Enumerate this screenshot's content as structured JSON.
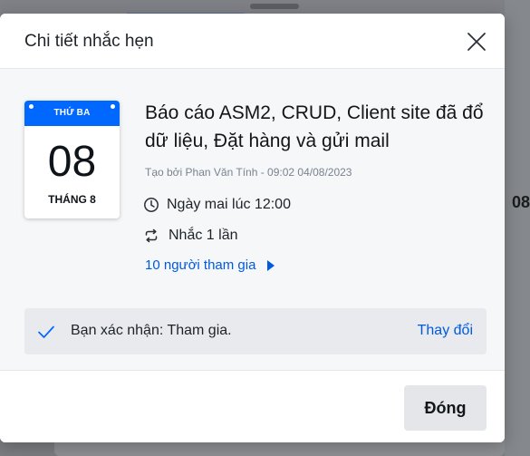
{
  "dialog": {
    "title": "Chi tiết nhắc hẹn",
    "close_icon": "close-icon"
  },
  "calendar": {
    "weekday": "THỨ BA",
    "day": "08",
    "month": "THÁNG 8",
    "accent_color": "#0068ff"
  },
  "event": {
    "title": "Báo cáo ASM2, CRUD, Client site đã đổ dữ liệu, Đặt hàng và gửi mail",
    "created_by": "Tạo bởi Phan Văn Tính - 09:02 04/08/2023",
    "time": "Ngày mai lúc 12:00",
    "time_icon": "clock-icon",
    "repeat": "Nhắc 1 lần",
    "repeat_icon": "repeat-icon",
    "participants": "10 người tham gia"
  },
  "confirmation": {
    "status": "Bạn xác nhận: Tham gia.",
    "change_label": "Thay đổi",
    "check_icon": "check-icon"
  },
  "footer": {
    "close_label": "Đóng"
  },
  "background": {
    "partial_text": "08"
  },
  "colors": {
    "link": "#005ae0",
    "primary": "#0068ff"
  }
}
